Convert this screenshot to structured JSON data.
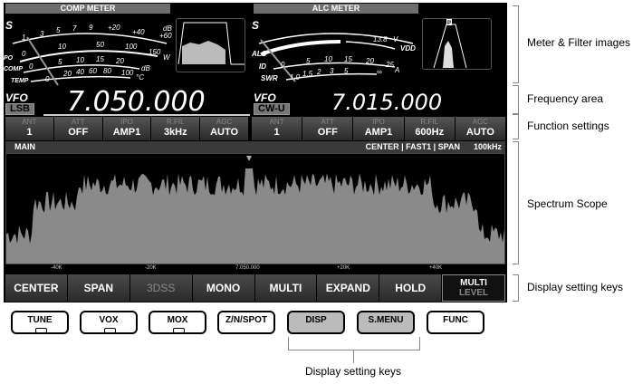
{
  "meters": {
    "comp_title": "COMP METER",
    "alc_title": "ALC METER",
    "comp_scales": {
      "s": "S",
      "po": "PO",
      "comp": "COMP",
      "temp": "TEMP",
      "s_ticks": [
        "1",
        "3",
        "5",
        "7",
        "9",
        "+20",
        "+40",
        "+60"
      ],
      "po_ticks": [
        "0",
        "10",
        "50",
        "100",
        "150"
      ],
      "comp_ticks": [
        "0",
        "5",
        "10",
        "15",
        "20"
      ],
      "temp_ticks": [
        "0",
        "20",
        "40",
        "60",
        "80",
        "100"
      ],
      "db": "dB",
      "w": "W",
      "c": "°C"
    },
    "alc_scales": {
      "s": "S",
      "alc": "ALC",
      "id": "ID",
      "swr": "SWR",
      "vdd": "VDD",
      "vdd_val": "13.8",
      "v": "V",
      "id_ticks": [
        "0",
        "5",
        "10",
        "15",
        "20",
        "25"
      ],
      "a": "A",
      "swr_ticks": [
        "1.0",
        "1.5",
        "2",
        "3",
        "5",
        "∞"
      ],
      "p_marker": "P"
    }
  },
  "vfo_main": {
    "label": "VFO",
    "mode": "LSB",
    "freq": "7.050.000"
  },
  "vfo_sub": {
    "label": "VFO",
    "mode": "CW-U",
    "freq": "7.015.000"
  },
  "func_main": [
    {
      "l": "ANT",
      "v": "1"
    },
    {
      "l": "ATT",
      "v": "OFF"
    },
    {
      "l": "IPO",
      "v": "AMP1"
    },
    {
      "l": "R.FIL",
      "v": "3kHz"
    },
    {
      "l": "AGC",
      "v": "AUTO"
    }
  ],
  "func_sub": [
    {
      "l": "ANT",
      "v": "1"
    },
    {
      "l": "ATT",
      "v": "OFF"
    },
    {
      "l": "IPO",
      "v": "AMP1"
    },
    {
      "l": "R.FIL",
      "v": "600Hz"
    },
    {
      "l": "AGC",
      "v": "AUTO"
    }
  ],
  "scope": {
    "title": "MAIN",
    "status": "CENTER | FAST1 | SPAN",
    "span": "100kHz",
    "scale": [
      "-40K",
      "-20K",
      "7.050.000",
      "+20K",
      "+40K"
    ]
  },
  "keys": [
    "CENTER",
    "SPAN",
    "3DSS",
    "MONO",
    "MULTI",
    "EXPAND",
    "HOLD"
  ],
  "key_multi": {
    "top": "MULTI",
    "bottom": "LEVEL"
  },
  "buttons": [
    "TUNE",
    "VOX",
    "MOX",
    "Z/N/SPOT",
    "DISP",
    "S.MENU",
    "FUNC"
  ],
  "callouts": {
    "meter": "Meter & Filter images",
    "freq": "Frequency area",
    "func": "Function settings",
    "scope": "Spectrum Scope",
    "display": "Display setting keys",
    "bottom": "Display setting keys"
  }
}
